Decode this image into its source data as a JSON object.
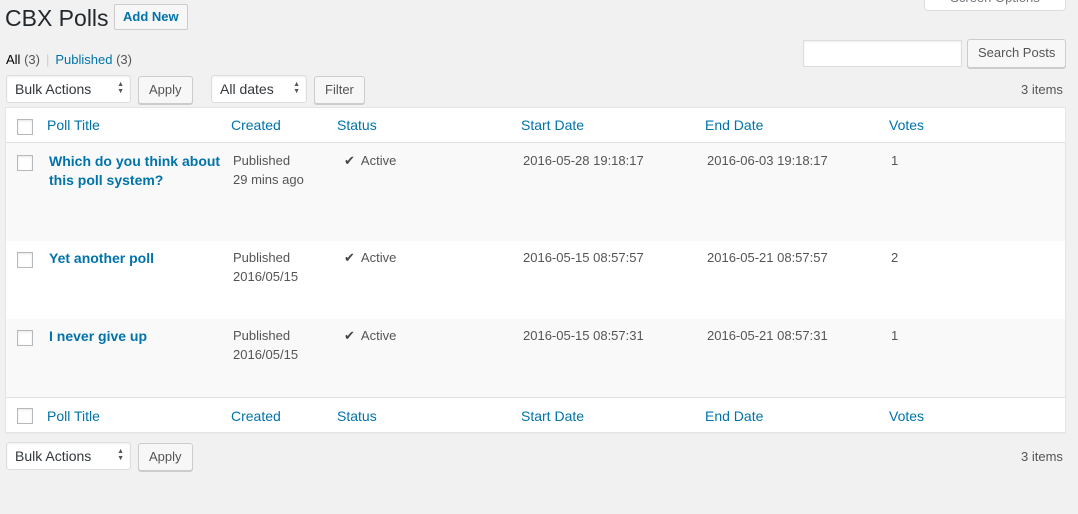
{
  "header": {
    "title": "CBX Polls",
    "add_new": "Add New",
    "screen_options": "Screen Options"
  },
  "views": {
    "all_label": "All",
    "all_count": "(3)",
    "separator": "|",
    "published_label": "Published",
    "published_count": "(3)"
  },
  "search": {
    "button": "Search Posts",
    "placeholder": ""
  },
  "top_nav": {
    "bulk_actions": "Bulk Actions",
    "apply": "Apply",
    "dates": "All dates",
    "filter": "Filter",
    "items": "3 items"
  },
  "bottom_nav": {
    "bulk_actions": "Bulk Actions",
    "apply": "Apply",
    "items": "3 items"
  },
  "columns": [
    "Poll Title",
    "Created",
    "Status",
    "Start Date",
    "End Date",
    "Votes"
  ],
  "rows": [
    {
      "title": "Which do you think about this poll system?",
      "created_status": "Published",
      "created_when": "29 mins ago",
      "status": "Active",
      "start": "2016-05-28 19:18:17",
      "end": "2016-06-03 19:18:17",
      "votes": "1"
    },
    {
      "title": "Yet another poll",
      "created_status": "Published",
      "created_when": "2016/05/15",
      "status": "Active",
      "start": "2016-05-15 08:57:57",
      "end": "2016-05-21 08:57:57",
      "votes": "2"
    },
    {
      "title": "I never give up",
      "created_status": "Published",
      "created_when": "2016/05/15",
      "status": "Active",
      "start": "2016-05-15 08:57:31",
      "end": "2016-05-21 08:57:31",
      "votes": "1"
    }
  ],
  "icons": {
    "status": "checkmark-icon",
    "select": "select-arrows-icon"
  }
}
